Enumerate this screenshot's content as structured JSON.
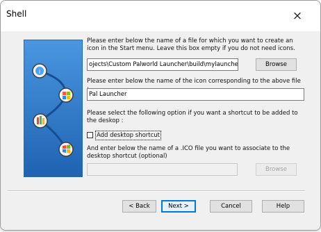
{
  "window": {
    "title": "Shell",
    "close_icon": "close-icon"
  },
  "side_image": {
    "icons": [
      "info-icon",
      "windows-settings-icon",
      "installer-icon",
      "windows-icon"
    ],
    "accent": "#2e7bd0"
  },
  "form": {
    "file_prompt": "Please enter below the name of a file for which you want to create an icon in the Start menu. Leave this box empty if you do not need icons.",
    "file_value": "ojects\\Custom Palworld Launcher\\build\\mylauncher.exe",
    "browse_label": "Browse",
    "icon_prompt": "Please enter below the name of the icon corresponding to the above file :",
    "icon_value": "Pal Launcher",
    "shortcut_prompt": "Please select the following option if you want a shortcut to be added to the deskop :",
    "shortcut_checkbox_label": "Add desktop shortcut",
    "shortcut_checked": false,
    "ico_prompt": "And enter below the name of a .ICO file you want to associate to the desktop shortcut (optional)",
    "ico_value": "",
    "ico_browse_label": "Browse"
  },
  "footer": {
    "back_label": "< Back",
    "next_label": "Next >",
    "cancel_label": "Cancel",
    "help_label": "Help"
  }
}
